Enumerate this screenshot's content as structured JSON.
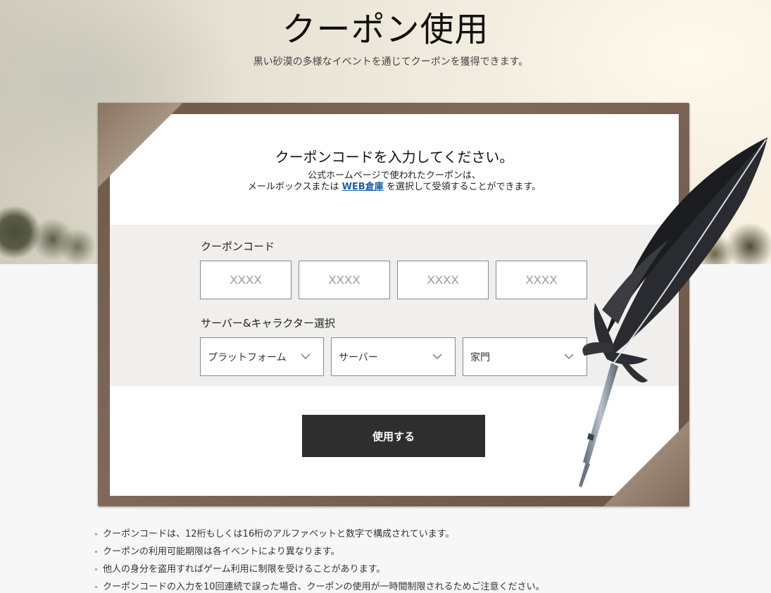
{
  "header": {
    "title": "クーポン使用",
    "subtitle": "黒い砂漠の多様なイベントを通じてクーポンを獲得できます。"
  },
  "card": {
    "heading": "クーポンコードを入力してください。",
    "desc_line1": "公式ホームページで使われたクーポンは、",
    "desc_line2_prefix": "メールボックスまたは ",
    "desc_link": "WEB倉庫",
    "desc_line2_suffix": " を選択して受領することができます。"
  },
  "form": {
    "code_label": "クーポンコード",
    "code_placeholders": [
      "XXXX",
      "XXXX",
      "XXXX",
      "XXXX"
    ],
    "select_label": "サーバー&キャラクター選択",
    "selects": [
      {
        "value": "プラットフォーム"
      },
      {
        "value": "サーバー"
      },
      {
        "value": "家門"
      }
    ],
    "submit_label": "使用する"
  },
  "notes": [
    "クーポンコードは、12桁もしくは16桁のアルファベットと数字で構成されています。",
    "クーポンの利用可能期限は各イベントにより異なります。",
    "他人の身分を盗用すればゲーム利用に制限を受けることがあります。",
    "クーポンコードの入力を10回連続で誤った場合、クーポンの使用が一時間制限されるためご注意ください。"
  ],
  "colors": {
    "frame": "#7a6454",
    "button": "#2e2e2e",
    "link": "#1f5fa8",
    "band": "#f0efed"
  },
  "icons": {
    "select_arrow": "chevron-down-icon",
    "decoration": "feather-quill-icon"
  }
}
